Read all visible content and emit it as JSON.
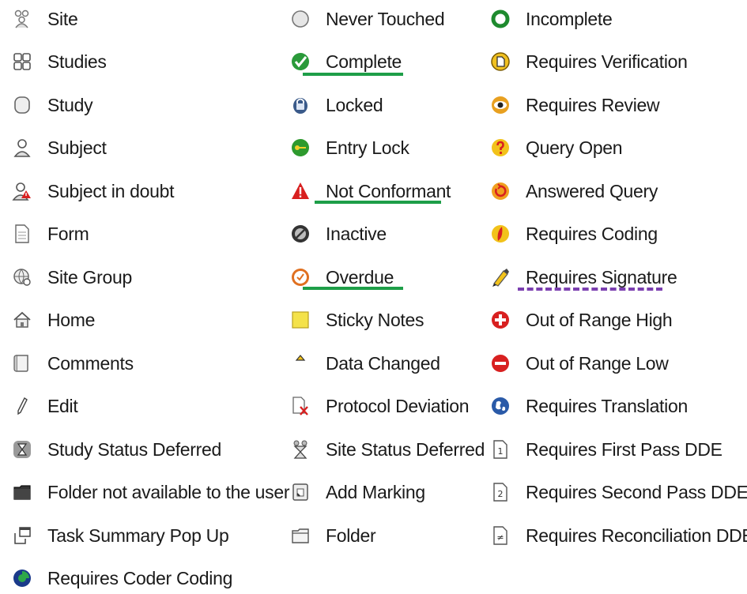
{
  "column1": [
    {
      "icon": "site-group-people-icon",
      "label": "Site"
    },
    {
      "icon": "studies-grid-icon",
      "label": "Studies"
    },
    {
      "icon": "study-cylinder-icon",
      "label": "Study"
    },
    {
      "icon": "subject-person-icon",
      "label": "Subject"
    },
    {
      "icon": "subject-doubt-icon",
      "label": "Subject in doubt"
    },
    {
      "icon": "form-document-icon",
      "label": "Form"
    },
    {
      "icon": "site-group-globe-icon",
      "label": "Site Group"
    },
    {
      "icon": "home-icon",
      "label": "Home"
    },
    {
      "icon": "comments-icon",
      "label": "Comments"
    },
    {
      "icon": "edit-pencil-icon",
      "label": "Edit"
    },
    {
      "icon": "hourglass-icon",
      "label": "Study Status Deferred"
    },
    {
      "icon": "folder-dark-icon",
      "label": "Folder not available to the user"
    },
    {
      "icon": "task-popup-icon",
      "label": "Task Summary Pop Up"
    },
    {
      "icon": "coder-coding-icon",
      "label": "Requires Coder Coding"
    }
  ],
  "column2": [
    {
      "icon": "never-touched-circle-icon",
      "label": "Never Touched"
    },
    {
      "icon": "complete-check-icon",
      "label": "Complete"
    },
    {
      "icon": "locked-padlock-icon",
      "label": "Locked"
    },
    {
      "icon": "entry-lock-key-icon",
      "label": "Entry Lock"
    },
    {
      "icon": "not-conformant-warning-icon",
      "label": "Not Conformant"
    },
    {
      "icon": "inactive-circle-icon",
      "label": "Inactive"
    },
    {
      "icon": "overdue-clock-icon",
      "label": "Overdue"
    },
    {
      "icon": "sticky-note-icon",
      "label": "Sticky Notes"
    },
    {
      "icon": "data-changed-triangle-icon",
      "label": "Data Changed"
    },
    {
      "icon": "protocol-deviation-icon",
      "label": "Protocol Deviation"
    },
    {
      "icon": "site-hourglass-icon",
      "label": "Site Status Deferred"
    },
    {
      "icon": "add-marking-icon",
      "label": "Add Marking"
    },
    {
      "icon": "folder-icon",
      "label": "Folder"
    }
  ],
  "column3": [
    {
      "icon": "incomplete-ring-icon",
      "label": "Incomplete"
    },
    {
      "icon": "requires-verification-icon",
      "label": "Requires Verification"
    },
    {
      "icon": "requires-review-eye-icon",
      "label": "Requires Review"
    },
    {
      "icon": "query-open-icon",
      "label": "Query Open"
    },
    {
      "icon": "answered-query-icon",
      "label": "Answered Query"
    },
    {
      "icon": "requires-coding-icon",
      "label": "Requires Coding"
    },
    {
      "icon": "requires-signature-pen-icon",
      "label": "Requires Signature"
    },
    {
      "icon": "out-of-range-high-icon",
      "label": "Out of Range High"
    },
    {
      "icon": "out-of-range-low-icon",
      "label": "Out of Range Low"
    },
    {
      "icon": "requires-translation-globe-icon",
      "label": "Requires Translation"
    },
    {
      "icon": "first-pass-dde-icon",
      "label": "Requires First Pass DDE"
    },
    {
      "icon": "second-pass-dde-icon",
      "label": "Requires Second Pass DDE"
    },
    {
      "icon": "reconciliation-dde-icon",
      "label": "Requires Reconciliation DDE"
    }
  ],
  "colors": {
    "green_underline": "#1e9e48",
    "purple_underline": "#7b3fb0"
  }
}
